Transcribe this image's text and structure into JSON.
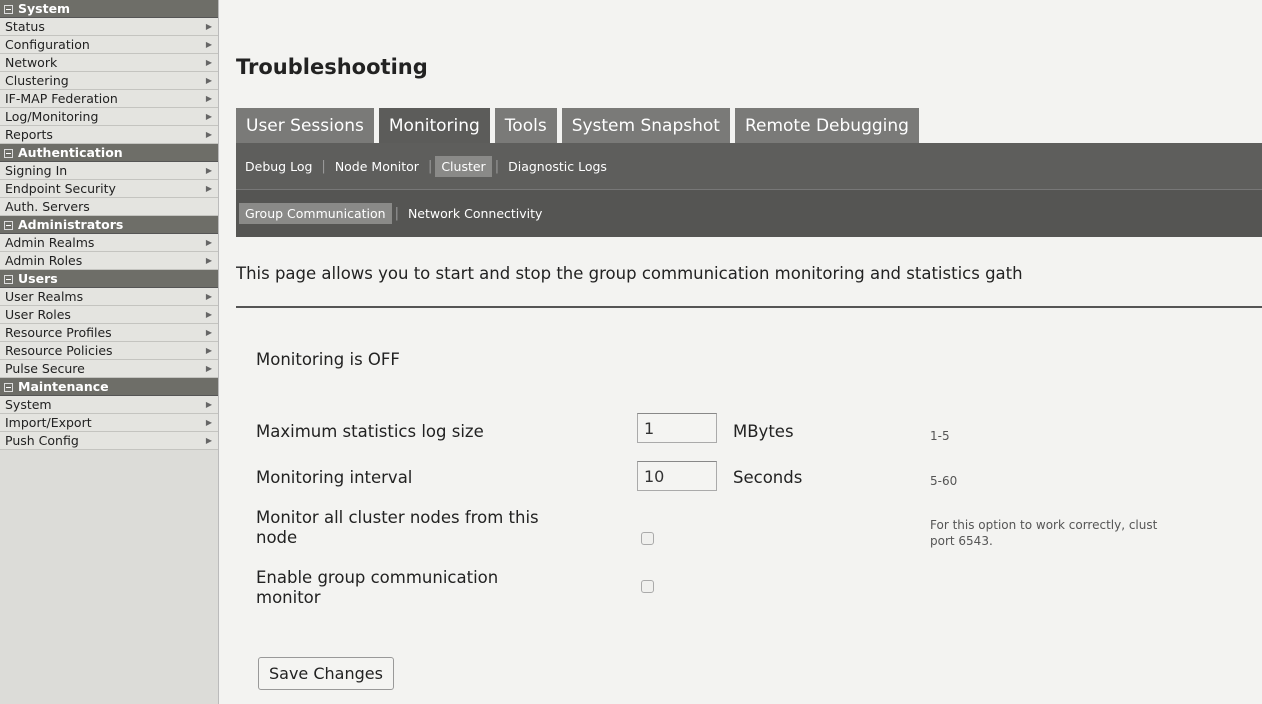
{
  "sidebar": {
    "system": {
      "header": "System",
      "items": [
        {
          "label": "Status"
        },
        {
          "label": "Configuration"
        },
        {
          "label": "Network"
        },
        {
          "label": "Clustering"
        },
        {
          "label": "IF-MAP Federation"
        },
        {
          "label": "Log/Monitoring"
        },
        {
          "label": "Reports"
        }
      ]
    },
    "authentication": {
      "header": "Authentication",
      "items": [
        {
          "label": "Signing In"
        },
        {
          "label": "Endpoint Security"
        },
        {
          "label": "Auth. Servers"
        }
      ]
    },
    "administrators": {
      "header": "Administrators",
      "items": [
        {
          "label": "Admin Realms"
        },
        {
          "label": "Admin Roles"
        }
      ]
    },
    "users": {
      "header": "Users",
      "items": [
        {
          "label": "User Realms"
        },
        {
          "label": "User Roles"
        },
        {
          "label": "Resource Profiles"
        },
        {
          "label": "Resource Policies"
        },
        {
          "label": "Pulse Secure"
        }
      ]
    },
    "maintenance": {
      "header": "Maintenance",
      "items": [
        {
          "label": "System"
        },
        {
          "label": "Import/Export"
        },
        {
          "label": "Push Config"
        }
      ]
    }
  },
  "page": {
    "title": "Troubleshooting",
    "tabs": [
      "User Sessions",
      "Monitoring",
      "Tools",
      "System Snapshot",
      "Remote Debugging"
    ],
    "active_tab": "Monitoring",
    "subnav1": [
      "Debug Log",
      "Node Monitor",
      "Cluster",
      "Diagnostic Logs"
    ],
    "subnav1_selected": "Cluster",
    "subnav2": [
      "Group Communication",
      "Network Connectivity"
    ],
    "subnav2_selected": "Group Communication",
    "description": "This page allows you to start and stop the group communication monitoring and statistics gath",
    "monitoring_status": "Monitoring is OFF"
  },
  "form": {
    "log_size": {
      "label": "Maximum statistics log size",
      "value": "1",
      "unit": "MBytes",
      "hint": "1-5"
    },
    "interval": {
      "label": "Monitoring interval",
      "value": "10",
      "unit": "Seconds",
      "hint": "5-60"
    },
    "monitor_all": {
      "label_line1": "Monitor all cluster nodes from this",
      "label_line2": "node",
      "checked": false,
      "hint_line1": "For this option to work correctly, clust",
      "hint_line2": "port 6543."
    },
    "enable_gc": {
      "label_line1": "Enable group communication",
      "label_line2": "monitor",
      "checked": false
    },
    "save_label": "Save Changes"
  }
}
